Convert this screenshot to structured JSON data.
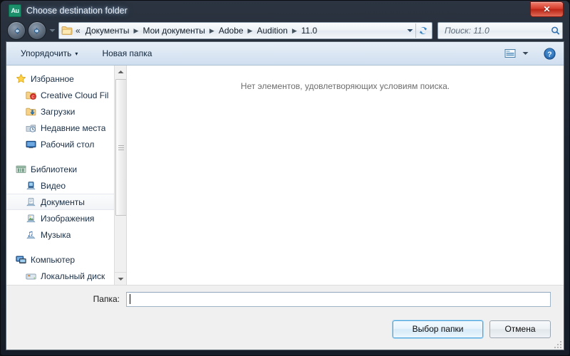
{
  "window": {
    "title": "Choose destination folder",
    "app_icon": "Au",
    "close_label": "✕"
  },
  "navigation": {
    "back_icon": "back-arrow-icon",
    "forward_icon": "forward-arrow-icon",
    "history_icon": "chevron-down-icon",
    "breadcrumb_overflow": "«",
    "breadcrumbs": [
      "Документы",
      "Мои документы",
      "Adobe",
      "Audition",
      "11.0"
    ],
    "separator": "▶",
    "dropdown_icon": "chevron-down-icon",
    "refresh_icon": "refresh-icon"
  },
  "search": {
    "placeholder": "Поиск: 11.0",
    "value": "",
    "icon": "search-icon"
  },
  "toolbar": {
    "organize_label": "Упорядочить",
    "organize_caret": "▾",
    "new_folder_label": "Новая папка",
    "view_icon": "view-mode-icon",
    "view_caret": "▾",
    "help_icon": "help-icon",
    "help_label": "?"
  },
  "sidebar": {
    "groups": [
      {
        "header": {
          "label": "Избранное",
          "icon": "star-icon"
        },
        "items": [
          {
            "label": "Creative Cloud Fil",
            "icon": "creative-cloud-folder-icon",
            "selected": false
          },
          {
            "label": "Загрузки",
            "icon": "downloads-folder-icon",
            "selected": false
          },
          {
            "label": "Недавние места",
            "icon": "recent-places-icon",
            "selected": false
          },
          {
            "label": "Рабочий стол",
            "icon": "desktop-icon",
            "selected": false
          }
        ]
      },
      {
        "header": {
          "label": "Библиотеки",
          "icon": "libraries-icon"
        },
        "items": [
          {
            "label": "Видео",
            "icon": "video-library-icon",
            "selected": false
          },
          {
            "label": "Документы",
            "icon": "documents-library-icon",
            "selected": true
          },
          {
            "label": "Изображения",
            "icon": "pictures-library-icon",
            "selected": false
          },
          {
            "label": "Музыка",
            "icon": "music-library-icon",
            "selected": false
          }
        ]
      },
      {
        "header": {
          "label": "Компьютер",
          "icon": "computer-icon"
        },
        "items": [
          {
            "label": "Локальный диск",
            "icon": "local-disk-icon",
            "selected": false
          }
        ]
      }
    ],
    "scrollbar": {
      "up_icon": "scroll-up-arrow-icon",
      "down_icon": "scroll-down-arrow-icon"
    }
  },
  "file_pane": {
    "empty_message": "Нет элементов, удовлетворяющих условиям поиска."
  },
  "footer": {
    "folder_label": "Папка:",
    "folder_value": "",
    "confirm_label": "Выбор папки",
    "cancel_label": "Отмена",
    "resize_grip": "resize-grip-icon"
  },
  "colors": {
    "title_bar": "#1b2430",
    "toolbar": "#dbe7f3",
    "accent_button_border": "#4ba3dd",
    "close_button": "#d53c2b",
    "empty_text": "#6d6d6d"
  }
}
